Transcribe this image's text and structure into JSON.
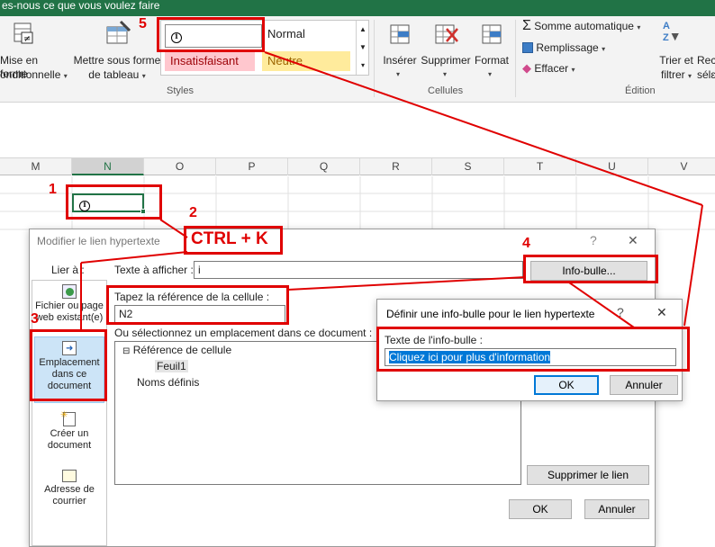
{
  "titlebar": {
    "text": "es-nous ce que vous voulez faire"
  },
  "ribbon": {
    "mise_en_forme_1": "Mise en forme",
    "mise_en_forme_2": "onditionnelle",
    "mettre_sous_forme_1": "Mettre sous forme",
    "mettre_sous_forme_2": "de tableau",
    "styles_group": "Styles",
    "style_normal": "Normal",
    "style_insatisfaisant": "Insatisfaisant",
    "style_neutre": "Neutre",
    "inserer": "Insérer",
    "supprimer": "Supprimer",
    "format": "Format",
    "cellules_group": "Cellules",
    "somme": "Somme automatique",
    "remplissage": "Remplissage",
    "effacer": "Effacer",
    "trier_1": "Trier et",
    "trier_2": "filtrer",
    "rech_1": "Rec",
    "rech_2": "sélε",
    "edition_group": "Édition"
  },
  "columns": [
    "M",
    "N",
    "O",
    "P",
    "Q",
    "R",
    "S",
    "T",
    "U",
    "V"
  ],
  "annotations": {
    "n1": "1",
    "n2": "2",
    "n3": "3",
    "n4": "4",
    "n5": "5",
    "shortcut": "CTRL + K"
  },
  "hyperlink_dialog": {
    "title": "Modifier le lien hypertexte",
    "help": "?",
    "close": "✕",
    "lier_a": "Lier à :",
    "side_fichier": "Fichier ou page web existant(e)",
    "side_emplacement": "Emplacement dans ce document",
    "side_creer": "Créer un document",
    "side_adresse": "Adresse de courrier",
    "texte_afficher_label": "Texte à afficher :",
    "texte_afficher_value": "i",
    "infobulle_button": "Info-bulle...",
    "reference_label": "Tapez la référence de la cellule :",
    "reference_value": "N2",
    "emplacement_label": "Ou sélectionnez un emplacement dans ce document :",
    "tree_ref": "Référence de cellule",
    "tree_feuil": "Feuil1",
    "tree_noms": "Noms définis",
    "supprimer_lien": "Supprimer le lien",
    "ok": "OK",
    "annuler": "Annuler"
  },
  "tooltip_dialog": {
    "title": "Définir une info-bulle pour le lien hypertexte",
    "help": "?",
    "close": "✕",
    "label": "Texte de l'info-bulle :",
    "value": "Cliquez ici pour plus d'information",
    "ok": "OK",
    "annuler": "Annuler"
  },
  "colors": {
    "excel_green": "#217346",
    "annotation_red": "#e00000",
    "selection_blue": "#cce4f7"
  }
}
